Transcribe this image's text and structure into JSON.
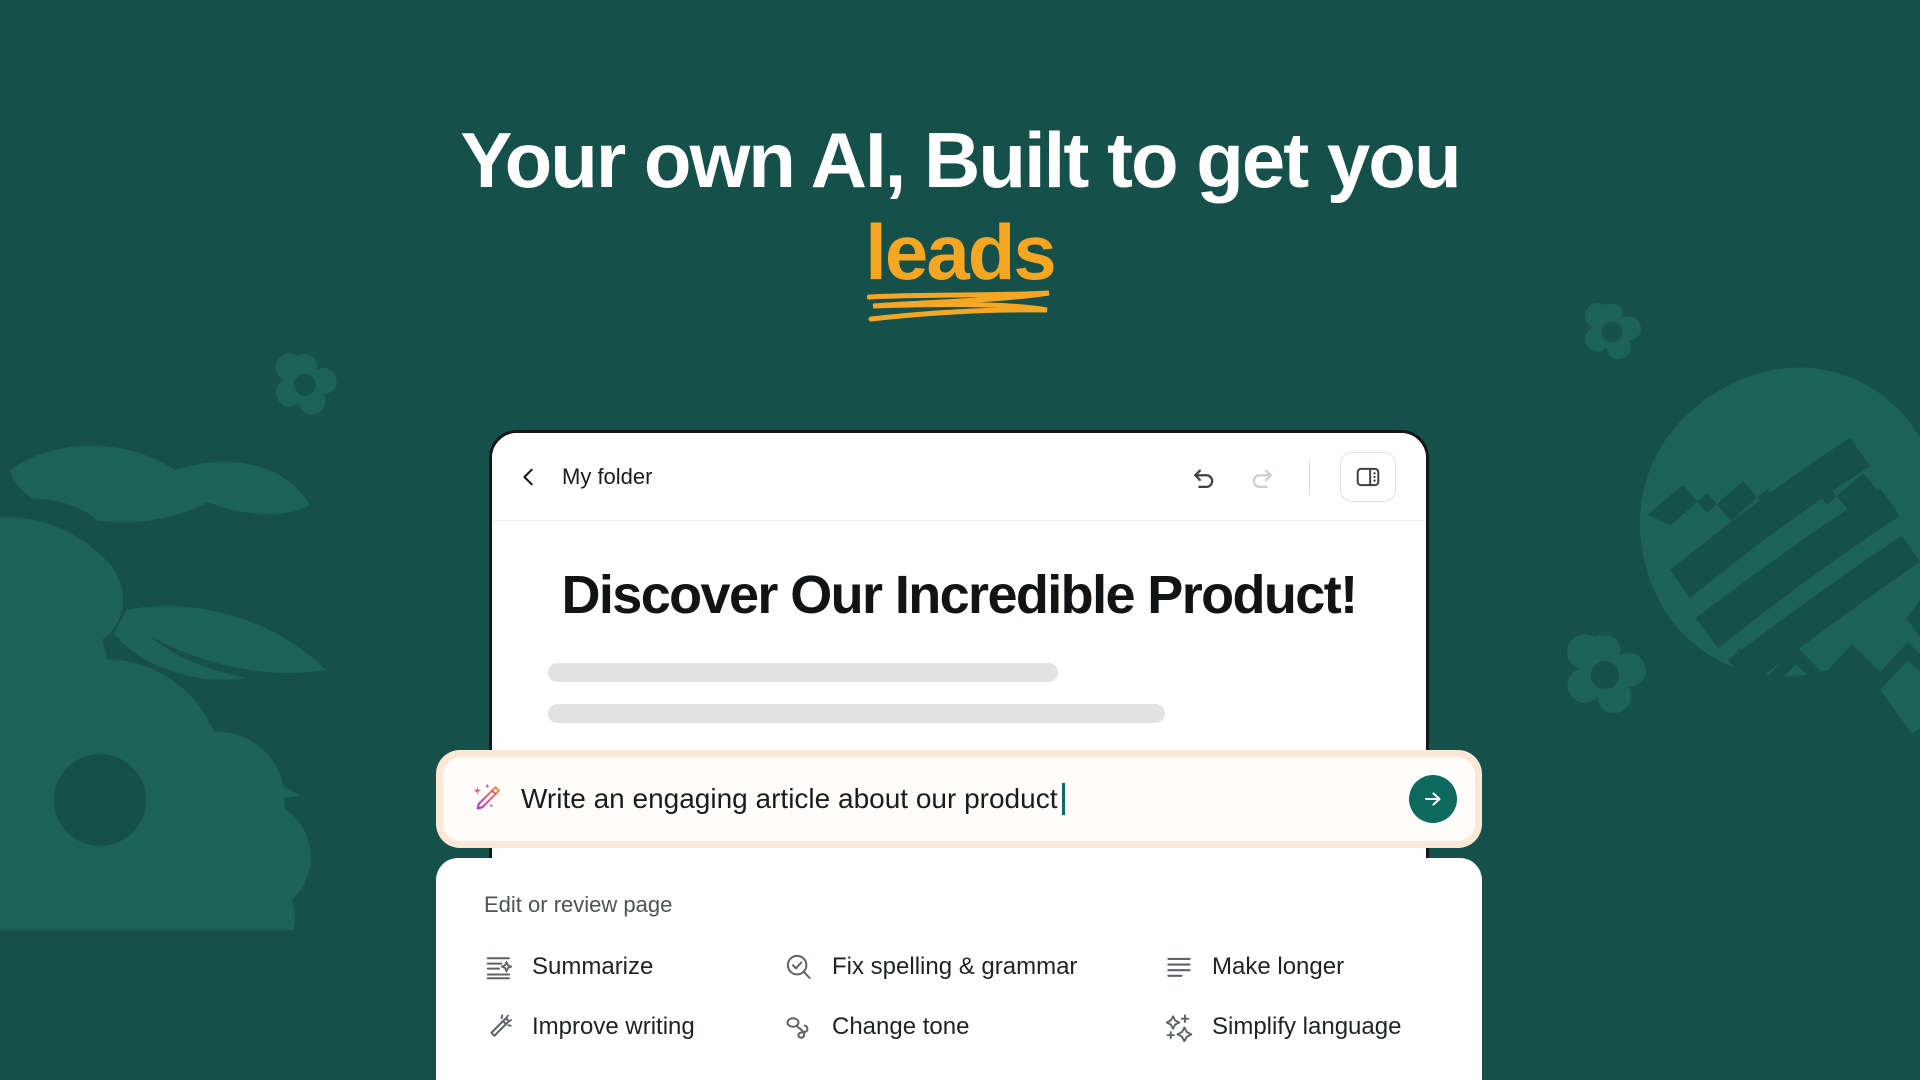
{
  "theme": {
    "background": "#15504a",
    "decor": "#1d6257",
    "accent_yellow": "#f5a623",
    "teal_button": "#0e6a5f",
    "prompt_border": "#fbe8d6"
  },
  "hero": {
    "line1": "Your own AI, Built to get you",
    "accent_word": "leads",
    "underline_icon": "hand-drawn-underline"
  },
  "app": {
    "toolbar": {
      "back_icon": "chevron-left-icon",
      "folder_label": "My folder",
      "undo_icon": "undo-icon",
      "redo_icon": "redo-icon",
      "panel_toggle_icon": "sidebar-panel-icon"
    },
    "document": {
      "title": "Discover Our Incredible Product!",
      "skeleton_lines": [
        62,
        75
      ]
    }
  },
  "prompt": {
    "wand_icon": "magic-wand-icon",
    "value": "Write an engaging article about our product",
    "placeholder": "Write an engaging article about our product",
    "send_icon": "arrow-right-icon"
  },
  "menu": {
    "heading": "Edit or review page",
    "items": [
      {
        "label": "Summarize",
        "icon": "summarize-icon"
      },
      {
        "label": "Fix spelling & grammar",
        "icon": "spellcheck-icon"
      },
      {
        "label": "Make longer",
        "icon": "make-longer-icon"
      },
      {
        "label": "Improve writing",
        "icon": "improve-writing-icon"
      },
      {
        "label": "Change tone",
        "icon": "change-tone-icon"
      },
      {
        "label": "Simplify language",
        "icon": "simplify-language-icon"
      }
    ]
  }
}
